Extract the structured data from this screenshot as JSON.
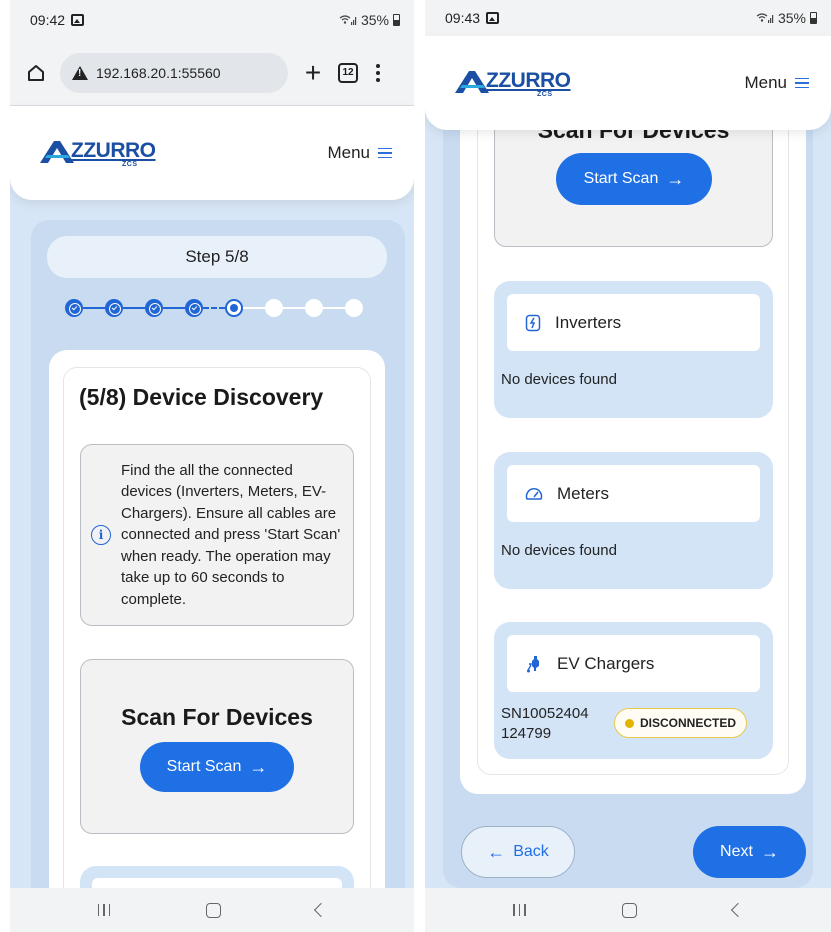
{
  "left": {
    "status": {
      "time": "09:42",
      "battery": "35%"
    },
    "browser": {
      "url": "192.168.20.1:55560",
      "tab_count": "12"
    },
    "header": {
      "menu_label": "Menu"
    },
    "step_label": "Step 5/8",
    "stepper": {
      "total": 8,
      "completed": 4,
      "current": 5
    },
    "section_title": "(5/8) Device Discovery",
    "info_text": "Find the all the connected devices (Inverters, Meters, EV-Chargers). Ensure all cables are connected and press 'Start Scan' when ready. The operation may take up to 60 seconds to complete.",
    "scan_title": "Scan For Devices",
    "scan_button": "Start Scan"
  },
  "right": {
    "status": {
      "time": "09:43",
      "battery": "35%"
    },
    "header": {
      "menu_label": "Menu"
    },
    "scan_title_partial": "Scan For Devices",
    "scan_button": "Start Scan",
    "inverters": {
      "title": "Inverters",
      "note": "No devices found"
    },
    "meters": {
      "title": "Meters",
      "note": "No devices found"
    },
    "ev_chargers": {
      "title": "EV Chargers",
      "serial_line1": "SN10052404",
      "serial_line2": "124799",
      "status": "DISCONNECTED"
    },
    "back_button": "Back",
    "next_button": "Next"
  },
  "logo": {
    "text": "ZZURRO",
    "sub": "ZCS"
  },
  "colors": {
    "primary": "#1f6fe5",
    "panel": "#d3e4f7",
    "badge_border": "#e8c84a",
    "badge_dot": "#e0b400"
  }
}
